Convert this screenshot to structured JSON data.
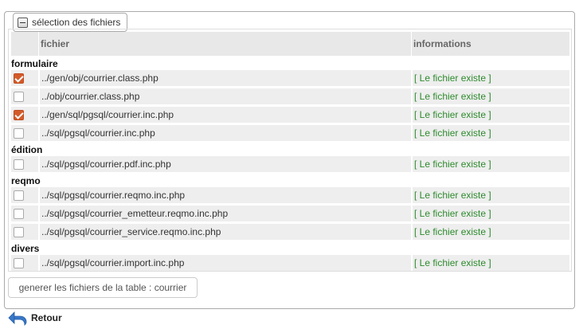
{
  "fieldset": {
    "legend": "sélection des fichiers",
    "collapse_icon": "minus-square-icon"
  },
  "table": {
    "headers": [
      "",
      "fichier",
      "informations"
    ],
    "groups": [
      {
        "title": "formulaire",
        "rows": [
          {
            "checked": true,
            "file": "../gen/obj/courrier.class.php",
            "info": "[ Le fichier existe ]"
          },
          {
            "checked": false,
            "file": "../obj/courrier.class.php",
            "info": "[ Le fichier existe ]"
          },
          {
            "checked": true,
            "file": "../gen/sql/pgsql/courrier.inc.php",
            "info": "[ Le fichier existe ]"
          },
          {
            "checked": false,
            "file": "../sql/pgsql/courrier.inc.php",
            "info": "[ Le fichier existe ]"
          }
        ]
      },
      {
        "title": "édition",
        "rows": [
          {
            "checked": false,
            "file": "../sql/pgsql/courrier.pdf.inc.php",
            "info": "[ Le fichier existe ]"
          }
        ]
      },
      {
        "title": "reqmo",
        "rows": [
          {
            "checked": false,
            "file": "../sql/pgsql/courrier.reqmo.inc.php",
            "info": "[ Le fichier existe ]"
          },
          {
            "checked": false,
            "file": "../sql/pgsql/courrier_emetteur.reqmo.inc.php",
            "info": "[ Le fichier existe ]"
          },
          {
            "checked": false,
            "file": "../sql/pgsql/courrier_service.reqmo.inc.php",
            "info": "[ Le fichier existe ]"
          }
        ]
      },
      {
        "title": "divers",
        "rows": [
          {
            "checked": false,
            "file": "../sql/pgsql/courrier.import.inc.php",
            "info": "[ Le fichier existe ]"
          }
        ]
      }
    ]
  },
  "actions": {
    "generate_label": "generer les fichiers de la table : courrier",
    "back_label": "Retour",
    "back_icon": "undo-arrow-icon"
  },
  "colors": {
    "info_text": "#2e8b2e",
    "checkbox_checked": "#d35b2a",
    "back_arrow": "#3a78c8"
  }
}
